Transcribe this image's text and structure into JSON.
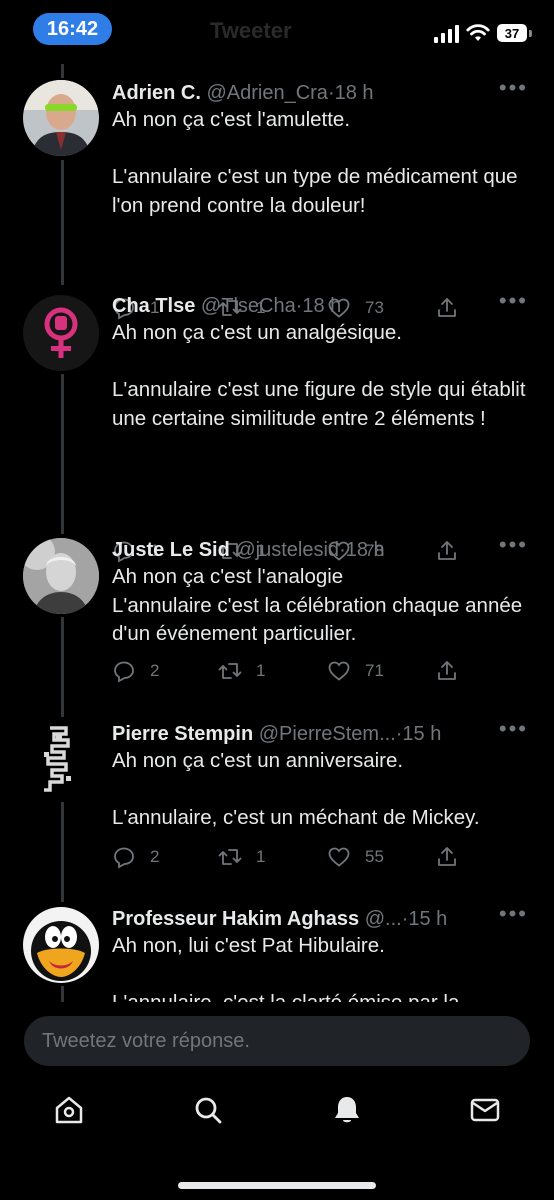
{
  "status_bar": {
    "time": "16:42",
    "battery": "37",
    "faded_title": "Tweeter"
  },
  "tweets": [
    {
      "name": "Adrien C.",
      "handle": "@Adrien_Cra",
      "time": "18 h",
      "text_1": "Ah non ça c'est l'amulette.",
      "text_2": "L'annulaire c'est un type de médicament que l'on prend contre la douleur!",
      "replies": "1",
      "retweets": "1",
      "likes": "73"
    },
    {
      "name": "Cha Tlse",
      "handle": "@TlseCha",
      "time": "18 h",
      "text_1": "Ah non ça c'est un analgésique.",
      "text_2": "L'annulaire c'est une figure de style qui établit une certaine similitude entre 2 éléments !",
      "replies": "1",
      "retweets": "1",
      "likes": "78"
    },
    {
      "name": "Juste Le Sid",
      "handle": "@justelesid",
      "time": "18 h",
      "text_1": "Ah non ça c'est l'analogie",
      "text_2": "L'annulaire c'est la célébration chaque année d'un événement particulier.",
      "replies": "2",
      "retweets": "1",
      "likes": "71"
    },
    {
      "name": "Pierre Stempin",
      "handle": "@PierreStem...",
      "time": "15 h",
      "text_1": "Ah non ça c'est un anniversaire.",
      "text_2": "L'annulaire, c'est un méchant de Mickey.",
      "replies": "2",
      "retweets": "1",
      "likes": "55"
    },
    {
      "name": "Professeur Hakim Aghass",
      "handle": "@...",
      "time": "15 h",
      "text_1": "Ah non, lui c'est Pat Hibulaire.",
      "text_2": "L'annulaire, c'est la clarté émise par la"
    }
  ],
  "separator": "·",
  "reply_box": {
    "placeholder": "Tweetez votre réponse."
  },
  "tabbar": [
    "home-icon",
    "search-icon",
    "notifications-icon",
    "messages-icon"
  ]
}
